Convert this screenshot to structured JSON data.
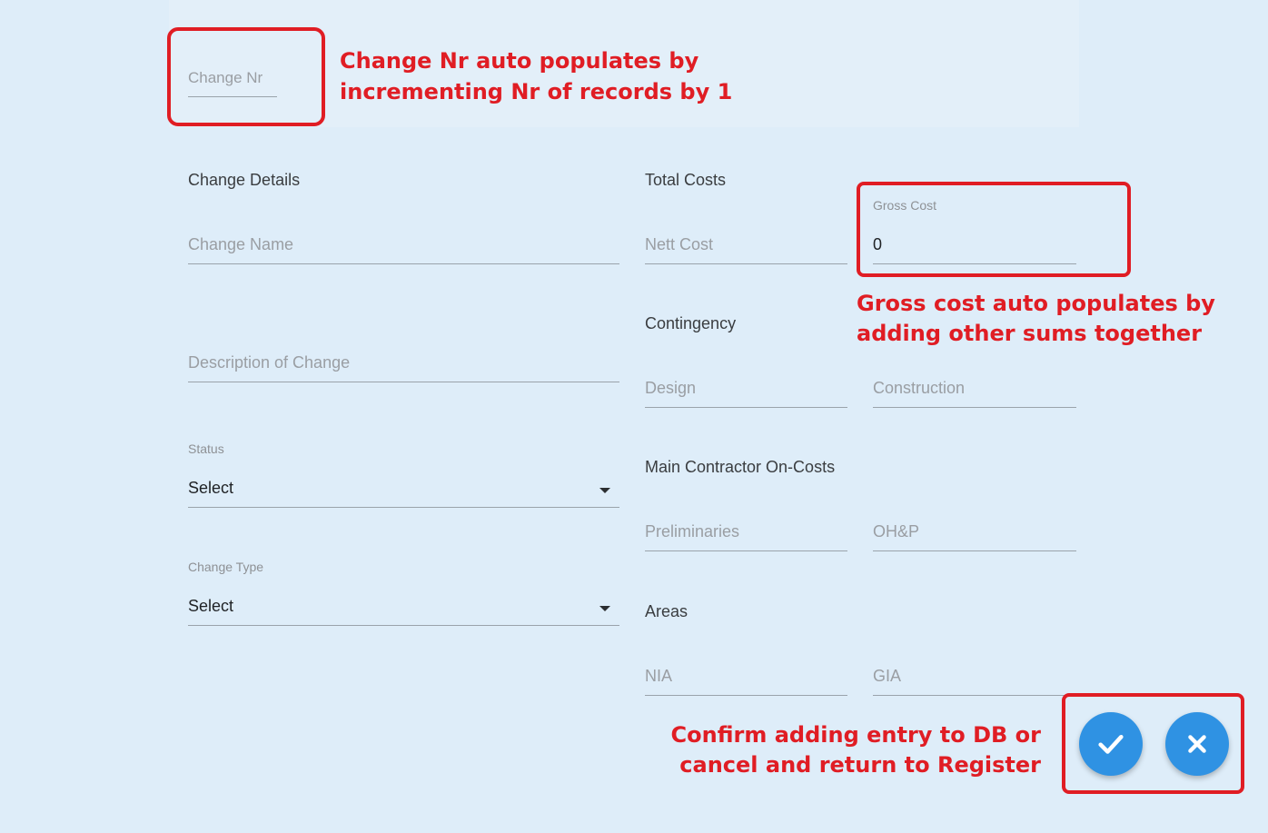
{
  "header": {
    "change_nr_placeholder": "Change Nr"
  },
  "change_details": {
    "title": "Change Details",
    "change_name_placeholder": "Change Name",
    "description_placeholder": "Description of Change",
    "status_label": "Status",
    "status_value": "Select",
    "change_type_label": "Change Type",
    "change_type_value": "Select"
  },
  "total_costs": {
    "title": "Total Costs",
    "nett_cost_placeholder": "Nett Cost",
    "gross_cost_label": "Gross Cost",
    "gross_cost_value": "0"
  },
  "contingency": {
    "title": "Contingency",
    "design_placeholder": "Design",
    "construction_placeholder": "Construction"
  },
  "main_contractor": {
    "title": "Main Contractor On-Costs",
    "preliminaries_placeholder": "Preliminaries",
    "ohp_placeholder": "OH&P"
  },
  "areas": {
    "title": "Areas",
    "nia_placeholder": "NIA",
    "gia_placeholder": "GIA"
  },
  "annotations": {
    "change_nr_line1": "Change Nr auto populates by",
    "change_nr_line2": "incrementing Nr of records by 1",
    "gross_cost_line1": "Gross cost auto populates by",
    "gross_cost_line2": "adding other sums together",
    "actions_line1": "Confirm adding entry to DB or",
    "actions_line2": "cancel and return to Register"
  },
  "actions": {
    "confirm_icon": "check-icon",
    "cancel_icon": "close-icon"
  },
  "colors": {
    "background": "#deedf9",
    "annotation_red": "#e01d24",
    "fab_blue": "#2f92e3"
  }
}
